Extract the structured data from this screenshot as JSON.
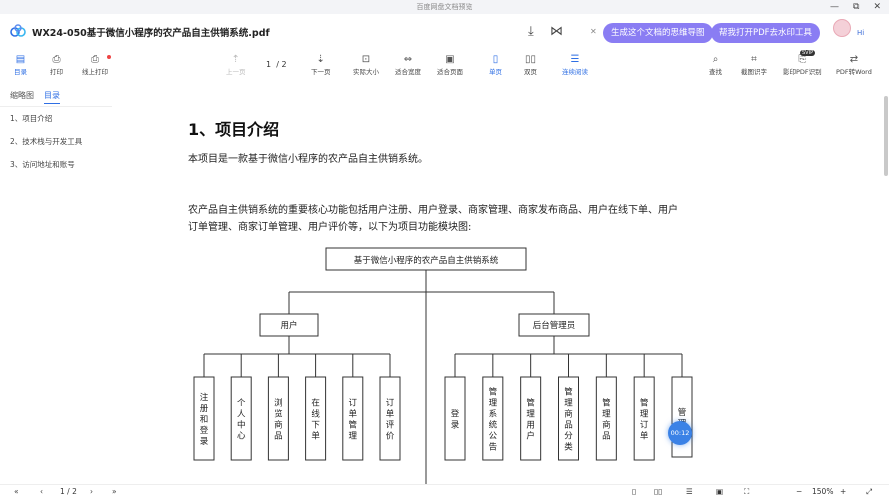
{
  "window": {
    "caption": "百度网盘文档预览",
    "minimize": "—",
    "restore": "⧉",
    "close": "✕"
  },
  "header": {
    "title": "WX24-050基于微信小程序的农产品自主供销系统.pdf",
    "promo1": "生成这个文档的思维导图",
    "promo2": "帮我打开PDF去水印工具",
    "greeting": "Hi"
  },
  "toolbar": {
    "toc": "目录",
    "print": "打印",
    "online_print": "线上打印",
    "prev": "上一页",
    "page_current": "1",
    "page_sep": "/",
    "page_total": "2",
    "next": "下一页",
    "actual": "实际大小",
    "fit_width": "适合宽度",
    "fit_page": "适合页面",
    "single": "单页",
    "double": "双页",
    "continuous": "连续阅读",
    "find": "查找",
    "screenshot": "截图识字",
    "ocr": "影印PDF识别",
    "vip": "SVIP",
    "to_word": "PDF转Word"
  },
  "sidebar": {
    "tabs": [
      "缩略图",
      "目录"
    ],
    "items": [
      "1、项目介绍",
      "2、技术栈与开发工具",
      "3、访问地址和账号"
    ]
  },
  "document": {
    "heading": "1、项目介绍",
    "para1": "本项目是一款基于微信小程序的农产品自主供销系统。",
    "para2_line1": "农产品自主供销系统的重要核心功能包括用户注册、用户登录、商家管理、商家发布商品、用户在线下单、用户",
    "para2_line2": "订单管理、商家订单管理、用户评价等，以下为项目功能模块图:",
    "diagram": {
      "root": "基于微信小程序的农产品自主供销系统",
      "branches": [
        {
          "name": "用户",
          "children": [
            "注册和登录",
            "个人中心",
            "浏览商品",
            "在线下单",
            "订单管理",
            "订单评价"
          ]
        },
        {
          "name": "后台管理员",
          "children": [
            "登录",
            "管理系统公告",
            "管理用户",
            "管理商品分类",
            "管理商品",
            "管理订单",
            "管理"
          ]
        }
      ]
    }
  },
  "bottom": {
    "first": "«",
    "prev": "‹",
    "page": "1 / 2",
    "next": "›",
    "last": "»",
    "zoom": "150%",
    "minus": "−",
    "plus": "+"
  },
  "timer": "00:12"
}
